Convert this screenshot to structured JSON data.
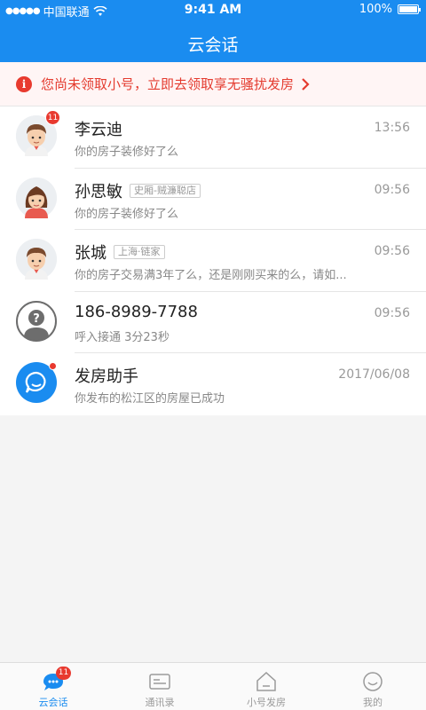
{
  "status_bar": {
    "carrier": "中国联通",
    "time": "9:41 AM",
    "battery": "100%"
  },
  "nav": {
    "title": "云会话"
  },
  "banner": {
    "text": "您尚未领取小号，立即去领取享无骚扰发房",
    "icon": "info-icon",
    "color": "#e43b2f"
  },
  "conversations": [
    {
      "name": "李云迪",
      "tag": "",
      "preview": "你的房子装修好了么",
      "time": "13:56",
      "avatar": "male-avatar",
      "badge": "11"
    },
    {
      "name": "孙思敏",
      "tag": "史厢-贼濂聪店",
      "preview": "你的房子装修好了么",
      "time": "09:56",
      "avatar": "female-avatar",
      "badge": ""
    },
    {
      "name": "张城",
      "tag": "上海·链家",
      "preview": "你的房子交易满3年了么，还是刚刚买来的么，请如...",
      "time": "09:56",
      "avatar": "male-avatar",
      "badge": ""
    },
    {
      "name": "186-8989-7788",
      "tag": "",
      "preview": "呼入接通 3分23秒",
      "time": "09:56",
      "avatar": "unknown-user-avatar",
      "badge": ""
    },
    {
      "name": "发房助手",
      "tag": "",
      "preview": "你发布的松江区的房屋已成功",
      "time": "2017/06/08",
      "avatar": "assistant-chat-avatar",
      "badge": "dot"
    }
  ],
  "tabs": [
    {
      "label": "云会话",
      "icon": "chat-bubble-icon",
      "active": true,
      "badge": "11"
    },
    {
      "label": "通讯录",
      "icon": "contacts-card-icon",
      "active": false
    },
    {
      "label": "小号发房",
      "icon": "house-icon",
      "active": false
    },
    {
      "label": "我的",
      "icon": "smile-face-icon",
      "active": false
    }
  ],
  "colors": {
    "brand": "#1a8cf0",
    "alert": "#e8392f"
  }
}
